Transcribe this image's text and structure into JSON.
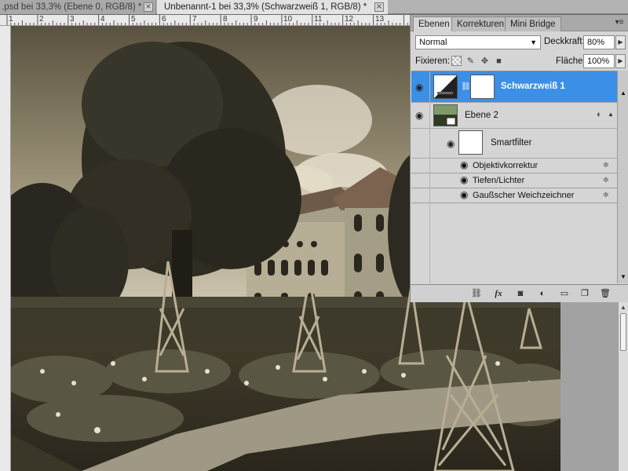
{
  "document_tabs": [
    {
      "label": ".psd bei 33,3% (Ebene 0, RGB/8) *",
      "active": false
    },
    {
      "label": "Unbenannt-1 bei 33,3% (Schwarzweiß 1, RGB/8) *",
      "active": true
    }
  ],
  "ruler": {
    "labels": [
      "1",
      "2",
      "3",
      "4",
      "5",
      "6",
      "7",
      "8",
      "9",
      "10",
      "11",
      "12",
      "13"
    ]
  },
  "panel": {
    "tabs": [
      "Ebenen",
      "Korrekturen",
      "Mini Bridge"
    ],
    "active_tab": "Ebenen",
    "blend_mode": "Normal",
    "opacity_label": "Deckkraft:",
    "opacity_value": "80%",
    "lock_label": "Fixieren:",
    "fill_label": "Fläche:",
    "fill_value": "100%"
  },
  "layers": [
    {
      "name": "Schwarzweiß 1",
      "type": "adjustment",
      "selected": true,
      "visible": true
    },
    {
      "name": "Ebene 2",
      "type": "smart-object",
      "selected": false,
      "visible": true,
      "smart_filter_label": "Smartfilter",
      "filters": [
        "Objektivkorrektur",
        "Tiefen/Lichter",
        "Gaußscher Weichzeichner"
      ]
    }
  ],
  "footer_icons": [
    "link-icon",
    "fx-icon",
    "mask-icon",
    "adjustment-icon",
    "folder-icon",
    "new-layer-icon",
    "trash-icon"
  ],
  "colors": {
    "selection": "#3c8fe6",
    "panel_bg": "#d5d5d5",
    "sepia_mid": "#6e6650"
  }
}
